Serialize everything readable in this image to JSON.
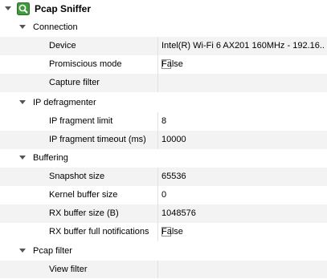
{
  "root": {
    "label": "Pcap Sniffer",
    "icon": "pcap-sniffer-icon"
  },
  "groups": {
    "connection": {
      "label": "Connection",
      "device_label": "Device",
      "device_value": "Intel(R) Wi-Fi 6 AX201 160MHz - 192.16...",
      "promiscuous_label": "Promiscious mode",
      "promiscuous_value": "False",
      "capture_filter_label": "Capture filter",
      "capture_filter_value": ""
    },
    "ip_defragmenter": {
      "label": "IP defragmenter",
      "fragment_limit_label": "IP fragment limit",
      "fragment_limit_value": "8",
      "fragment_timeout_label": "IP fragment timeout (ms)",
      "fragment_timeout_value": "10000"
    },
    "buffering": {
      "label": "Buffering",
      "snapshot_label": "Snapshot size",
      "snapshot_value": "65536",
      "kernel_buffer_label": "Kernel buffer size",
      "kernel_buffer_value": "0",
      "rx_buffer_label": "RX buffer size (B)",
      "rx_buffer_value": "1048576",
      "rx_notifications_label": "RX buffer full notifications",
      "rx_notifications_value": "False"
    },
    "pcap_filter": {
      "label": "Pcap filter",
      "view_filter_label": "View filter",
      "view_filter_value": ""
    }
  },
  "colors": {
    "icon_green": "#3e9a3a",
    "alt_row": "#f3f3f3",
    "expander": "#555555"
  }
}
